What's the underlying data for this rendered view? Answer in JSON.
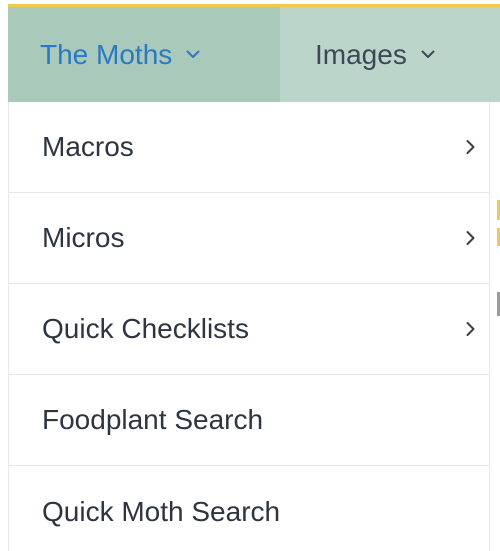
{
  "navbar": {
    "items": [
      {
        "label": "The Moths",
        "icon": "chevron-down-icon",
        "active": true,
        "color": "#2a79c5"
      },
      {
        "label": "Images",
        "icon": "chevron-down-icon",
        "active": false,
        "color": "#3f4656"
      }
    ],
    "background": "#bcd5ca",
    "active_background": "#a9c9bb"
  },
  "dropdown": {
    "items": [
      {
        "label": "Macros",
        "has_submenu": true,
        "icon": "chevron-right-icon"
      },
      {
        "label": "Micros",
        "has_submenu": true,
        "icon": "chevron-right-icon"
      },
      {
        "label": "Quick Checklists",
        "has_submenu": true,
        "icon": "chevron-right-icon"
      },
      {
        "label": "Foodplant Search",
        "has_submenu": false
      },
      {
        "label": "Quick Moth Search",
        "has_submenu": false
      }
    ]
  },
  "accent_color": "#f2c94c"
}
